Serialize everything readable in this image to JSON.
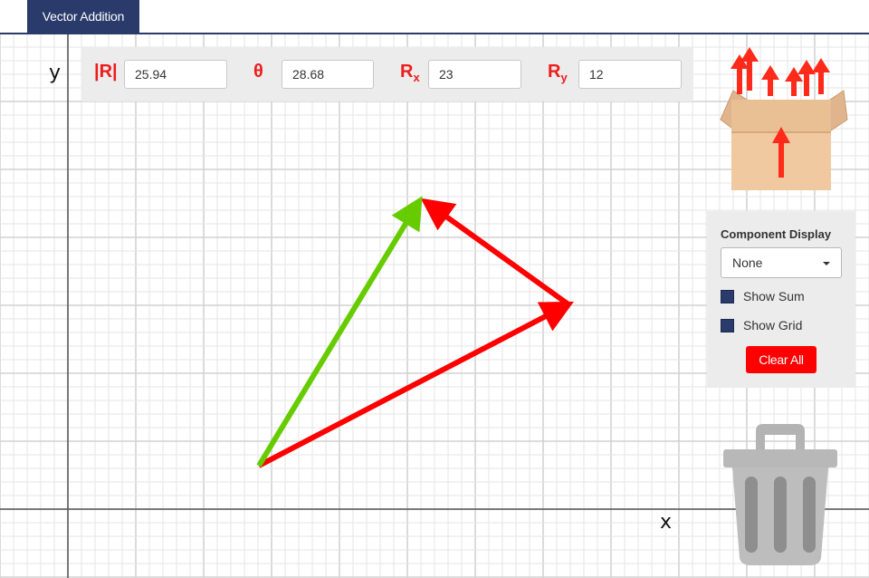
{
  "app": {
    "tab_label": "Vector Addition"
  },
  "axes": {
    "x_label": "x",
    "y_label": "y"
  },
  "resultant": {
    "magnitude_label": "|R|",
    "magnitude_value": "25.94",
    "angle_label": "θ",
    "angle_value": "28.68",
    "rx_label": "R",
    "rx_sub": "x",
    "rx_value": "23",
    "ry_label": "R",
    "ry_sub": "y",
    "ry_value": "12"
  },
  "component_panel": {
    "title": "Component Display",
    "selected": "None",
    "show_sum_label": "Show Sum",
    "show_grid_label": "Show Grid",
    "clear_label": "Clear All"
  },
  "colors": {
    "vector": "#ff0000",
    "sum_vector": "#66cc00",
    "accent": "#2a3a6a",
    "grid_minor": "#e6e6e6",
    "grid_major": "#d2d2d2"
  },
  "icons": {
    "vector_box": "box-of-vectors-icon",
    "trash": "trash-can-icon"
  }
}
